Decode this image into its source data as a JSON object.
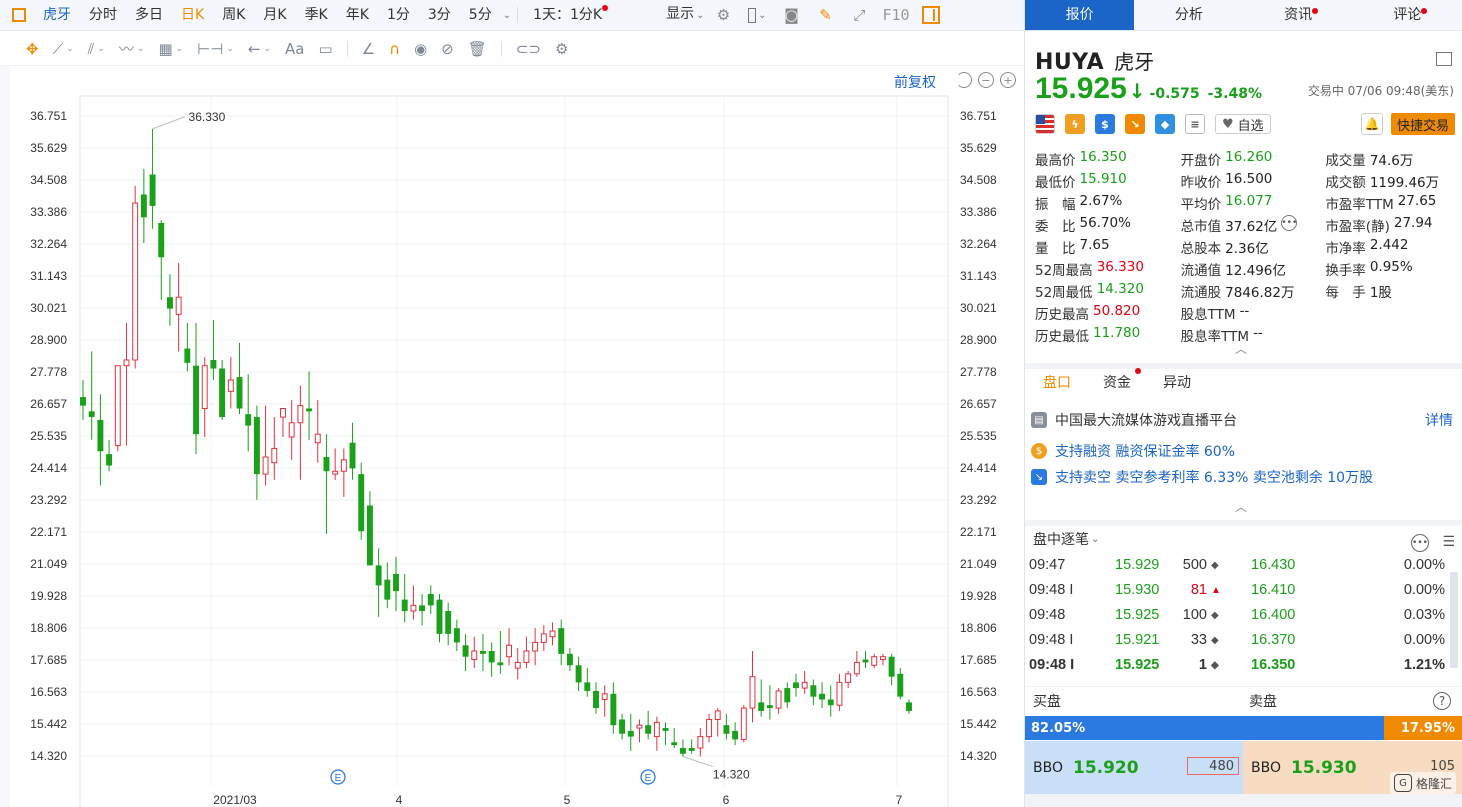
{
  "toolbar": {
    "tabs": [
      "虎牙",
      "分时",
      "多日",
      "日K",
      "周K",
      "月K",
      "季K",
      "年K",
      "1分",
      "3分",
      "5分"
    ],
    "active_tab": "日K",
    "period_selector": "1天：1分K",
    "display_label": "显示",
    "f10_label": "F10"
  },
  "chart": {
    "restore_label": "前复权",
    "y_ticks": [
      "36.751",
      "35.629",
      "34.508",
      "33.386",
      "32.264",
      "31.143",
      "30.021",
      "28.900",
      "27.778",
      "26.657",
      "25.535",
      "24.414",
      "23.292",
      "22.171",
      "21.049",
      "19.928",
      "18.806",
      "17.685",
      "16.563",
      "15.442",
      "14.320"
    ],
    "x_labels": [
      "2021/03",
      "4",
      "5",
      "6",
      "7"
    ],
    "high_label": "36.330",
    "low_label": "14.320",
    "event_marker": "E"
  },
  "chart_data": {
    "type": "candlestick",
    "ylim": [
      14.32,
      36.751
    ],
    "x_labels": [
      "2021/03",
      "4",
      "5",
      "6",
      "7"
    ],
    "annotations": [
      {
        "text": "36.330",
        "kind": "period-high"
      },
      {
        "text": "14.320",
        "kind": "period-low"
      }
    ],
    "candles": [
      [
        26.9,
        27.5,
        26.1,
        26.6
      ],
      [
        26.4,
        28.5,
        25.4,
        26.2
      ],
      [
        26.1,
        27.0,
        23.8,
        25.0
      ],
      [
        24.9,
        25.4,
        24.3,
        24.5
      ],
      [
        25.2,
        28.0,
        25.0,
        28.0
      ],
      [
        28.0,
        29.5,
        25.2,
        28.2
      ],
      [
        28.2,
        34.3,
        27.9,
        33.7
      ],
      [
        34.0,
        34.9,
        32.3,
        33.2
      ],
      [
        34.7,
        36.3,
        32.8,
        33.6
      ],
      [
        33.0,
        33.1,
        30.3,
        31.8
      ],
      [
        30.4,
        31.2,
        29.4,
        30.0
      ],
      [
        29.8,
        31.6,
        28.5,
        30.4
      ],
      [
        28.6,
        29.5,
        27.8,
        28.1
      ],
      [
        28.0,
        29.5,
        24.9,
        25.6
      ],
      [
        26.5,
        28.3,
        25.5,
        28.0
      ],
      [
        28.2,
        29.6,
        27.5,
        27.9
      ],
      [
        27.9,
        28.2,
        26.1,
        26.2
      ],
      [
        27.1,
        28.3,
        26.5,
        27.5
      ],
      [
        27.6,
        28.8,
        26.3,
        26.5
      ],
      [
        26.3,
        27.7,
        25.0,
        25.9
      ],
      [
        26.2,
        26.6,
        23.3,
        24.2
      ],
      [
        24.2,
        26.6,
        23.8,
        24.8
      ],
      [
        24.6,
        26.2,
        24.0,
        25.1
      ],
      [
        26.2,
        26.5,
        25.5,
        26.5
      ],
      [
        25.5,
        26.8,
        24.7,
        26.0
      ],
      [
        26.0,
        27.3,
        24.0,
        26.6
      ],
      [
        26.5,
        27.8,
        25.4,
        26.4
      ],
      [
        25.3,
        26.8,
        24.6,
        25.6
      ],
      [
        24.8,
        25.6,
        22.1,
        24.3
      ],
      [
        24.2,
        25.1,
        24.0,
        24.3
      ],
      [
        24.3,
        25.1,
        23.4,
        24.7
      ],
      [
        25.3,
        26.0,
        24.0,
        24.4
      ],
      [
        24.2,
        24.6,
        21.9,
        22.2
      ],
      [
        23.1,
        23.6,
        21.0,
        21.0
      ],
      [
        21.0,
        21.6,
        19.2,
        20.3
      ],
      [
        20.5,
        21.1,
        19.5,
        19.8
      ],
      [
        20.7,
        21.3,
        19.4,
        20.1
      ],
      [
        19.8,
        20.7,
        19.0,
        19.4
      ],
      [
        19.4,
        20.3,
        19.1,
        19.6
      ],
      [
        19.6,
        20.0,
        18.9,
        19.4
      ],
      [
        20.0,
        20.3,
        19.3,
        19.6
      ],
      [
        19.8,
        20.0,
        18.3,
        18.6
      ],
      [
        19.4,
        19.7,
        18.2,
        18.6
      ],
      [
        18.8,
        19.1,
        18.0,
        18.3
      ],
      [
        18.2,
        18.6,
        17.3,
        17.8
      ],
      [
        17.7,
        18.5,
        17.4,
        18.0
      ],
      [
        18.0,
        18.6,
        17.3,
        17.9
      ],
      [
        18.0,
        18.3,
        17.1,
        17.6
      ],
      [
        17.6,
        18.7,
        17.2,
        17.5
      ],
      [
        17.8,
        18.8,
        17.5,
        18.2
      ],
      [
        17.4,
        18.1,
        17.0,
        17.6
      ],
      [
        17.6,
        18.5,
        17.4,
        18.0
      ],
      [
        18.0,
        18.8,
        17.5,
        18.3
      ],
      [
        18.3,
        18.9,
        18.0,
        18.6
      ],
      [
        18.5,
        19.0,
        18.2,
        18.7
      ],
      [
        18.8,
        19.1,
        17.5,
        17.9
      ],
      [
        17.9,
        18.1,
        17.3,
        17.5
      ],
      [
        17.5,
        17.8,
        16.6,
        16.9
      ],
      [
        16.9,
        17.4,
        16.4,
        16.6
      ],
      [
        16.6,
        16.9,
        15.8,
        16.0
      ],
      [
        16.3,
        16.8,
        15.7,
        16.5
      ],
      [
        16.5,
        16.9,
        15.1,
        15.4
      ],
      [
        15.6,
        15.8,
        14.9,
        15.1
      ],
      [
        15.2,
        15.8,
        14.5,
        15.0
      ],
      [
        15.3,
        15.6,
        14.8,
        15.4
      ],
      [
        15.4,
        15.9,
        14.9,
        15.1
      ],
      [
        15.0,
        15.7,
        14.5,
        15.5
      ],
      [
        15.3,
        15.5,
        14.7,
        15.2
      ],
      [
        14.8,
        15.3,
        14.6,
        14.7
      ],
      [
        14.6,
        14.9,
        14.3,
        14.4
      ],
      [
        14.6,
        14.9,
        14.4,
        14.5
      ],
      [
        14.6,
        15.3,
        14.3,
        15.0
      ],
      [
        15.0,
        15.8,
        14.8,
        15.6
      ],
      [
        15.6,
        16.0,
        15.0,
        15.9
      ],
      [
        15.4,
        15.8,
        14.9,
        15.1
      ],
      [
        15.2,
        15.5,
        14.7,
        14.9
      ],
      [
        14.9,
        16.1,
        14.8,
        16.0
      ],
      [
        16.0,
        18.0,
        15.5,
        17.1
      ],
      [
        16.2,
        17.0,
        15.7,
        15.9
      ],
      [
        16.1,
        16.8,
        15.6,
        16.0
      ],
      [
        16.0,
        16.7,
        15.8,
        16.6
      ],
      [
        16.7,
        16.9,
        16.0,
        16.2
      ],
      [
        16.9,
        17.2,
        16.4,
        16.7
      ],
      [
        16.7,
        17.3,
        16.5,
        16.9
      ],
      [
        16.8,
        17.0,
        16.1,
        16.4
      ],
      [
        16.5,
        16.9,
        16.0,
        16.3
      ],
      [
        16.3,
        16.8,
        15.7,
        16.1
      ],
      [
        16.1,
        17.2,
        15.9,
        16.9
      ],
      [
        16.9,
        17.3,
        16.7,
        17.2
      ],
      [
        17.2,
        18.0,
        17.1,
        17.6
      ],
      [
        17.7,
        18.0,
        17.4,
        17.6
      ],
      [
        17.5,
        17.9,
        17.4,
        17.8
      ],
      [
        17.7,
        17.9,
        17.5,
        17.8
      ],
      [
        17.8,
        17.9,
        16.8,
        17.1
      ],
      [
        17.2,
        17.4,
        16.3,
        16.4
      ],
      [
        16.2,
        16.3,
        15.8,
        15.9
      ]
    ]
  },
  "right_tabs": [
    "报价",
    "分析",
    "资讯",
    "评论"
  ],
  "stock": {
    "code": "HUYA",
    "name": "虎牙",
    "price": "15.925",
    "change": "-0.575",
    "change_pct": "-3.48%",
    "status": "交易中 07/06 09:48(美东)",
    "fav_label": "自选",
    "quick_trade": "快捷交易"
  },
  "quote": [
    [
      {
        "l": "最高价",
        "v": "16.350",
        "c": "green"
      },
      {
        "l": "开盘价",
        "v": "16.260",
        "c": "green"
      },
      {
        "l": "成交量",
        "v": "74.6万",
        "c": ""
      }
    ],
    [
      {
        "l": "最低价",
        "v": "15.910",
        "c": "green"
      },
      {
        "l": "昨收价",
        "v": "16.500",
        "c": ""
      },
      {
        "l": "成交额",
        "v": "1199.46万",
        "c": ""
      }
    ],
    [
      {
        "l": "振　幅",
        "v": "2.67%",
        "c": ""
      },
      {
        "l": "平均价",
        "v": "16.077",
        "c": "green"
      },
      {
        "l": "市盈率TTM",
        "v": "27.65",
        "c": ""
      }
    ],
    [
      {
        "l": "委　比",
        "v": "56.70%",
        "c": ""
      },
      {
        "l": "总市值",
        "v": "37.62亿",
        "c": ""
      },
      {
        "l": "市盈率(静)",
        "v": "27.94",
        "c": ""
      }
    ],
    [
      {
        "l": "量　比",
        "v": "7.65",
        "c": ""
      },
      {
        "l": "总股本",
        "v": "2.36亿",
        "c": ""
      },
      {
        "l": "市净率",
        "v": "2.442",
        "c": ""
      }
    ],
    [
      {
        "l": "52周最高",
        "v": "36.330",
        "c": "red"
      },
      {
        "l": "流通值",
        "v": "12.496亿",
        "c": ""
      },
      {
        "l": "换手率",
        "v": "0.95%",
        "c": ""
      }
    ],
    [
      {
        "l": "52周最低",
        "v": "14.320",
        "c": "green"
      },
      {
        "l": "流通股",
        "v": "7846.82万",
        "c": ""
      },
      {
        "l": "每　手",
        "v": "1股",
        "c": ""
      }
    ],
    [
      {
        "l": "历史最高",
        "v": "50.820",
        "c": "red"
      },
      {
        "l": "股息TTM",
        "v": "--",
        "c": ""
      },
      null
    ],
    [
      {
        "l": "历史最低",
        "v": "11.780",
        "c": "green"
      },
      {
        "l": "股息率TTM",
        "v": "--",
        "c": ""
      },
      null
    ]
  ],
  "sub_tabs": [
    "盘口",
    "资金",
    "异动"
  ],
  "info": {
    "company": "中国最大流媒体游戏直播平台",
    "detail_link": "详情",
    "margin": "支持融资  融资保证金率 60%",
    "short": "支持卖空  卖空参考利率 6.33%  卖空池剩余 10万股"
  },
  "ticks": {
    "title": "盘中逐笔",
    "rows": [
      {
        "time": "09:47",
        "price": "15.929",
        "vol": "500",
        "dir": "◆",
        "red": false,
        "p2": "16.430",
        "pct": "0.00%"
      },
      {
        "time": "09:48 I",
        "price": "15.930",
        "vol": "81",
        "dir": "▲",
        "red": true,
        "p2": "16.410",
        "pct": "0.00%"
      },
      {
        "time": "09:48",
        "price": "15.925",
        "vol": "100",
        "dir": "◆",
        "red": false,
        "p2": "16.400",
        "pct": "0.03%"
      },
      {
        "time": "09:48 I",
        "price": "15.921",
        "vol": "33",
        "dir": "◆",
        "red": false,
        "p2": "16.370",
        "pct": "0.00%"
      },
      {
        "time": "09:48 I",
        "price": "15.925",
        "vol": "1",
        "dir": "◆",
        "red": false,
        "p2": "16.350",
        "pct": "1.21%"
      }
    ]
  },
  "orderbook": {
    "buy_label": "买盘",
    "sell_label": "卖盘",
    "buy_pct": "82.05%",
    "sell_pct": "17.95%",
    "buy_ratio": 0.8205,
    "bbo_label": "BBO",
    "bid_price": "15.920",
    "bid_size": "480",
    "ask_price": "15.930",
    "ask_size": "105"
  },
  "watermark": "格隆汇"
}
